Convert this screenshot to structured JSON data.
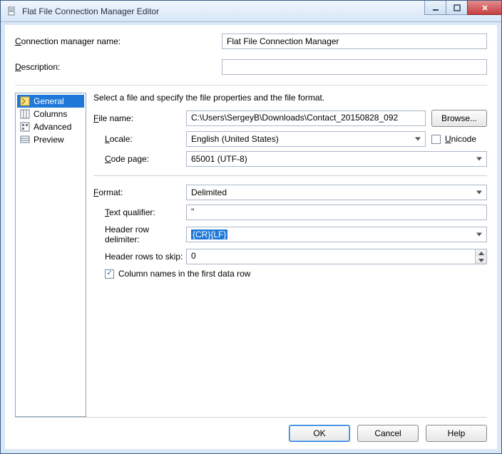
{
  "window": {
    "title": "Flat File Connection Manager Editor"
  },
  "top": {
    "conn_name_label": "Connection manager name:",
    "conn_name_value": "Flat File Connection Manager",
    "description_label": "Description:",
    "description_value": ""
  },
  "nav": {
    "items": [
      {
        "icon": "general-icon",
        "label": "General",
        "selected": true
      },
      {
        "icon": "columns-icon",
        "label": "Columns",
        "selected": false
      },
      {
        "icon": "advanced-icon",
        "label": "Advanced",
        "selected": false
      },
      {
        "icon": "preview-icon",
        "label": "Preview",
        "selected": false
      }
    ]
  },
  "general": {
    "instruction": "Select a file and specify the file properties and the file format.",
    "file_name_label": "File name:",
    "file_name_value": "C:\\Users\\SergeyB\\Downloads\\Contact_20150828_092",
    "browse_label": "Browse...",
    "locale_label": "Locale:",
    "locale_value": "English (United States)",
    "unicode_label": "Unicode",
    "unicode_checked": false,
    "codepage_label": "Code page:",
    "codepage_value": "65001 (UTF-8)",
    "format_label": "Format:",
    "format_value": "Delimited",
    "text_qualifier_label": "Text qualifier:",
    "text_qualifier_value": "\"",
    "header_delim_label": "Header row delimiter:",
    "header_delim_value": "{CR}{LF}",
    "header_skip_label": "Header rows to skip:",
    "header_skip_value": "0",
    "first_row_label": "Column names in the first data row",
    "first_row_checked": true
  },
  "footer": {
    "ok": "OK",
    "cancel": "Cancel",
    "help": "Help"
  }
}
